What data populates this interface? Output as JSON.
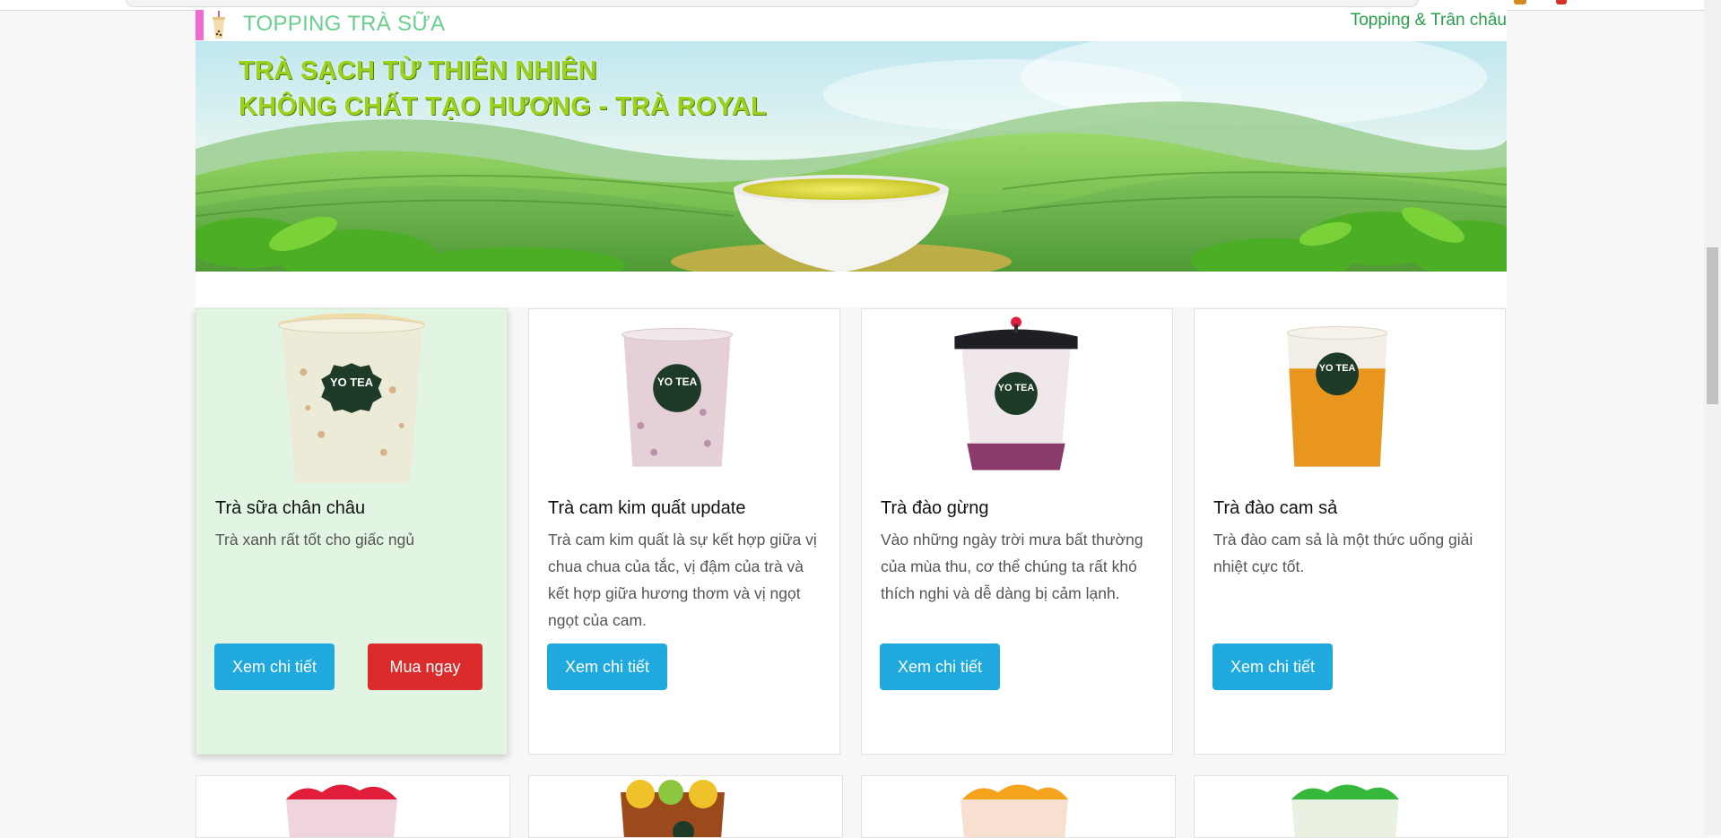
{
  "category": {
    "title": "TOPPING TRÀ SỮA",
    "link": "Topping & Trân châu"
  },
  "banner": {
    "line1": "TRÀ SẠCH TỪ THIÊN NHIÊN",
    "line2": "KHÔNG CHẤT TẠO HƯƠNG - TRÀ ROYAL"
  },
  "products": [
    {
      "name": "Trà sữa chân châu",
      "description": "Trà xanh rất tốt cho giấc ngủ",
      "detail_label": "Xem chi tiết",
      "buy_label": "Mua ngay",
      "logo": "YO TEA"
    },
    {
      "name": "Trà cam kim quất update",
      "description": "Trà cam kim quất là sự kết hợp giữa vị chua chua của tắc, vị đậm của trà và kết hợp giữa hương thơm và vị ngọt ngọt của cam.",
      "detail_label": "Xem chi tiết",
      "logo": "YO TEA"
    },
    {
      "name": "Trà đào gừng",
      "description": "Vào những ngày trời mưa bất thường của mùa thu, cơ thể chúng ta rất khó thích nghi và dễ dàng bị cảm lạnh.",
      "detail_label": "Xem chi tiết",
      "logo": "YO TEA"
    },
    {
      "name": "Trà đào cam sả",
      "description": "Trà đào cam sả là một thức uống giải nhiệt cực tốt.",
      "detail_label": "Xem chi tiết",
      "logo": "YO TEA"
    }
  ],
  "next_row": [
    {
      "icon": "red-jelly-milk-tea-cup-icon"
    },
    {
      "icon": "lemon-tea-cup-icon"
    },
    {
      "icon": "orange-jelly-tea-cup-icon"
    },
    {
      "icon": "green-jelly-tea-cup-icon"
    }
  ],
  "colors": {
    "accent_green": "#68d08c",
    "link_green": "#26a04a",
    "detail_button": "#1fa9df",
    "buy_button": "#dc2b2b",
    "active_card": "#e2f4e2"
  }
}
